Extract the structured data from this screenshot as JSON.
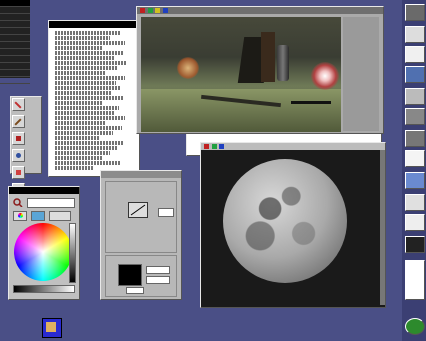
{
  "colors": {
    "desktop": "#4a4f86",
    "window_title": "#000000",
    "panel": "#c0c0c0"
  },
  "menu": {
    "title": "",
    "items": [
      "",
      "",
      "",
      "",
      "",
      "",
      "",
      "",
      "",
      "",
      ""
    ]
  },
  "tools_icons": [
    "pencil-icon",
    "brush-icon",
    "line-icon",
    "airbrush-icon",
    "eraser-icon",
    "fill-icon",
    "eyedropper-icon",
    "magnify-icon",
    "rect-icon",
    "ellipse-icon",
    "select-icon",
    "lasso-icon"
  ],
  "color_window": {
    "title": "",
    "icons": [
      "magnifier-icon",
      "swatch-icon",
      "palette-icon"
    ]
  },
  "text_window": {
    "title": ""
  },
  "render_window": {
    "title": "",
    "icons": [
      "close-icon",
      "color-icon",
      "grid-icon",
      "zoom-icon"
    ]
  },
  "dialog": {
    "title": "",
    "section1": "",
    "section2": ""
  },
  "moon_window": {
    "title": "",
    "icons": [
      "close-icon",
      "color-icon",
      "grid-icon"
    ]
  },
  "dock": {
    "icons": [
      "app-icon",
      "note-icon",
      "text-icon",
      "monitor-icon",
      "printer-icon",
      "cd-icon",
      "tools-icon",
      "document-icon",
      "folder-icon",
      "mail-icon",
      "file-icon",
      "image-icon",
      "blank-icon",
      "globe-icon"
    ]
  },
  "desktop_icon": "paint-app-icon"
}
